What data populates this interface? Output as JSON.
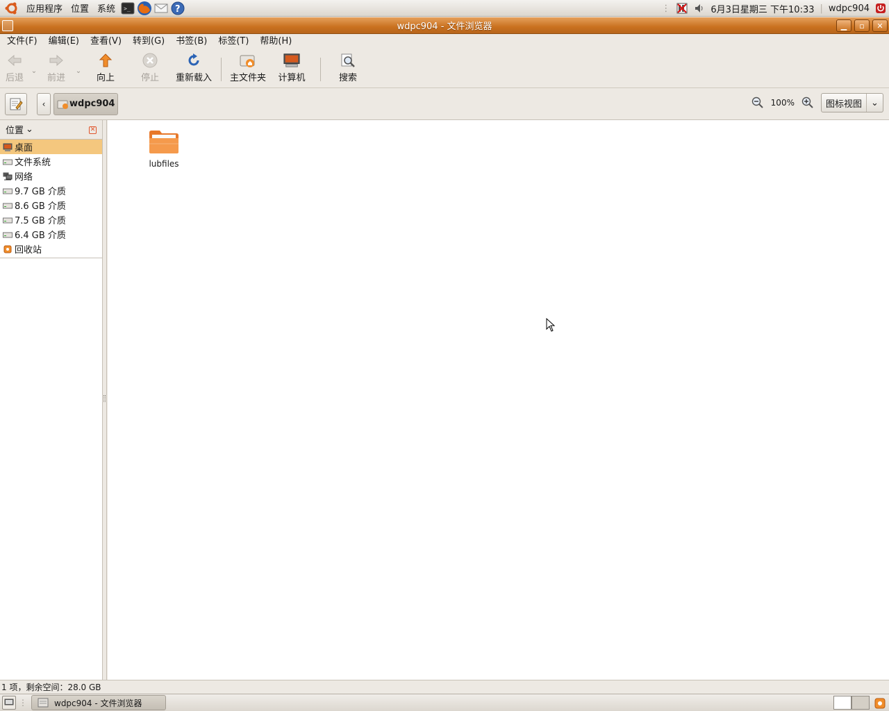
{
  "top_panel": {
    "menus": [
      "应用程序",
      "位置",
      "系统"
    ],
    "launchers": [
      "terminal-icon",
      "firefox-icon",
      "mail-icon",
      "help-icon"
    ],
    "clock": "6月3日星期三 下午10:33",
    "user": "wdpc904"
  },
  "window": {
    "title": "wdpc904 - 文件浏览器",
    "menubar": [
      "文件(F)",
      "编辑(E)",
      "查看(V)",
      "转到(G)",
      "书签(B)",
      "标签(T)",
      "帮助(H)"
    ],
    "toolbar": {
      "back": "后退",
      "forward": "前进",
      "up": "向上",
      "stop": "停止",
      "reload": "重新载入",
      "home": "主文件夹",
      "computer": "计算机",
      "search": "搜索"
    },
    "location": {
      "path_button": "wdpc904",
      "zoom": "100%",
      "view_mode": "图标视图"
    },
    "sidebar": {
      "title": "位置",
      "items": [
        {
          "label": "桌面",
          "icon": "desktop-icon",
          "selected": true
        },
        {
          "label": "文件系统",
          "icon": "drive-icon",
          "selected": false
        },
        {
          "label": "网络",
          "icon": "network-icon",
          "selected": false
        },
        {
          "label": "9.7 GB 介质",
          "icon": "drive-icon",
          "selected": false
        },
        {
          "label": "8.6 GB 介质",
          "icon": "drive-icon",
          "selected": false
        },
        {
          "label": "7.5 GB 介质",
          "icon": "drive-icon",
          "selected": false
        },
        {
          "label": "6.4 GB 介质",
          "icon": "drive-icon",
          "selected": false
        },
        {
          "label": "回收站",
          "icon": "trash-icon",
          "selected": false
        }
      ]
    },
    "files": [
      {
        "name": "lubfiles",
        "icon": "folder-icon"
      }
    ],
    "status": "1 项，剩余空间：28.0 GB"
  },
  "bottom_panel": {
    "task": "wdpc904 - 文件浏览器"
  },
  "colors": {
    "titlebar": "#c9711f",
    "selection": "#f4c77e",
    "panel": "#dcd7cf"
  }
}
